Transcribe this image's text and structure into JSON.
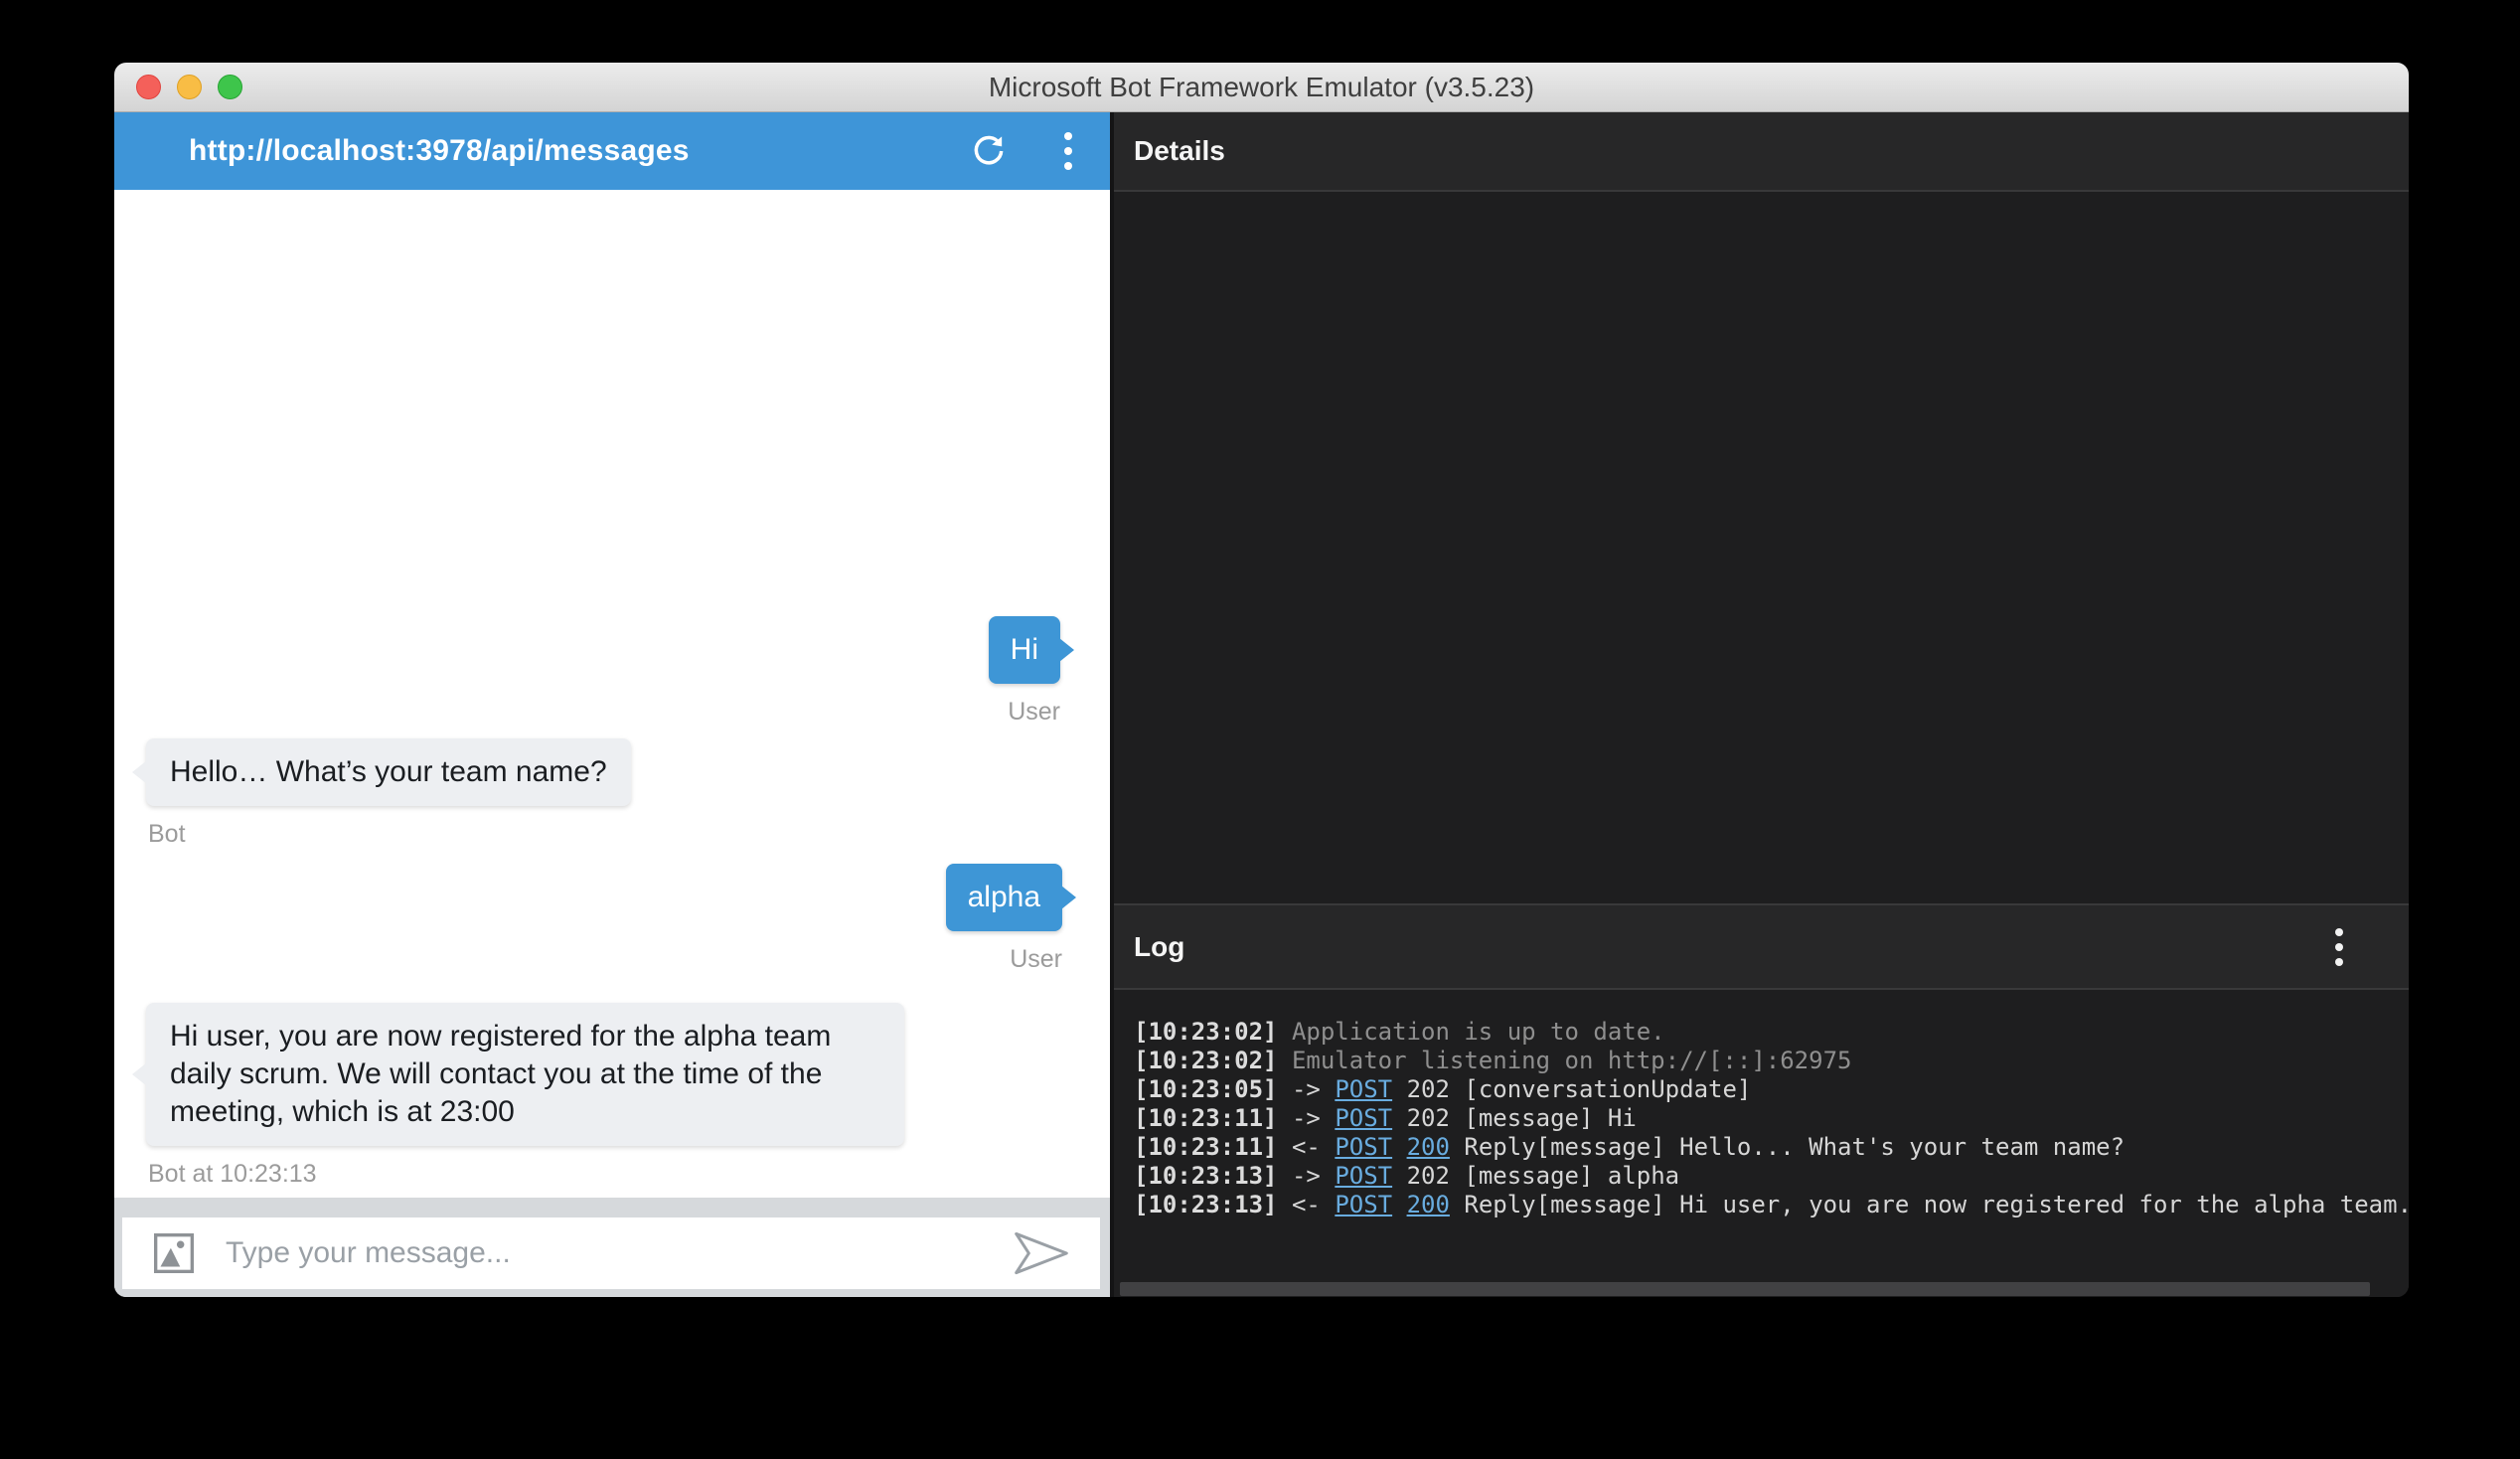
{
  "window": {
    "title": "Microsoft Bot Framework Emulator (v3.5.23)"
  },
  "chat_panel": {
    "endpoint_url": "http://localhost:3978/api/messages",
    "messages": [
      {
        "author": "user",
        "text": "Hi",
        "label": "User"
      },
      {
        "author": "bot",
        "text": "Hello… What’s your team name?",
        "label": "Bot"
      },
      {
        "author": "user",
        "text": "alpha",
        "label": "User"
      },
      {
        "author": "bot",
        "text": "Hi user, you are now registered for the alpha team daily scrum. We will contact you at the time of the meeting, which is at 23:00",
        "label": "Bot at 10:23:13"
      }
    ],
    "composer": {
      "placeholder": "Type your message..."
    }
  },
  "details_panel": {
    "title": "Details"
  },
  "log_panel": {
    "title": "Log",
    "entries": [
      {
        "time": "[10:23:02]",
        "text": "Application is up to date."
      },
      {
        "time": "[10:23:02]",
        "text": "Emulator listening on http://[::]:62975"
      },
      {
        "time": "[10:23:05]",
        "arrow": "->",
        "method": "POST",
        "status": "202",
        "text": "[conversationUpdate]"
      },
      {
        "time": "[10:23:11]",
        "arrow": "->",
        "method": "POST",
        "status": "202",
        "text": "[message] Hi"
      },
      {
        "time": "[10:23:11]",
        "arrow": "<-",
        "method": "POST",
        "status": "200",
        "text": "Reply[message] Hello... What's your team name?"
      },
      {
        "time": "[10:23:13]",
        "arrow": "->",
        "method": "POST",
        "status": "202",
        "text": "[message] alpha"
      },
      {
        "time": "[10:23:13]",
        "arrow": "<-",
        "method": "POST",
        "status": "200",
        "text": "Reply[message] Hi user, you are now registered for the alpha team."
      }
    ]
  },
  "icons": [
    "refresh-icon",
    "overflow-menu-icon",
    "attach-image-icon",
    "send-icon",
    "log-menu-icon"
  ],
  "colors": {
    "header_blue": "#3e95d8",
    "user_bubble_blue": "#3e96d6",
    "bot_bubble_gray": "#edeff2",
    "link_blue": "#69acdf",
    "panel_dark": "#1e1e1f",
    "panel_header_dark": "#272728",
    "traffic_red": "#f4605a",
    "traffic_yellow": "#f8bd45",
    "traffic_green": "#3ec54b"
  }
}
